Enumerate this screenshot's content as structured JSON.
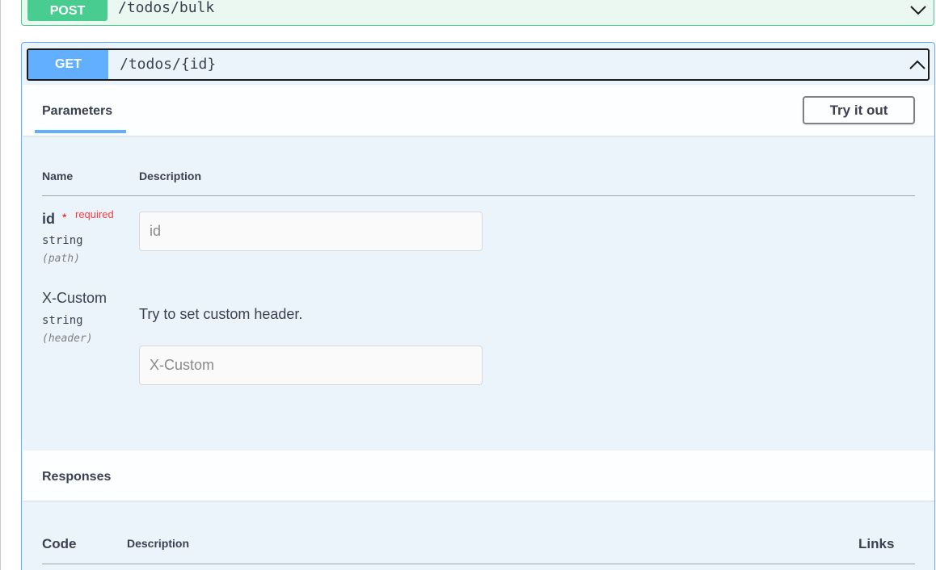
{
  "post_op": {
    "method": "POST",
    "path": "/todos/bulk"
  },
  "get_op": {
    "method": "GET",
    "path": "/todos/{id}"
  },
  "parameters": {
    "tab_label": "Parameters",
    "try_button": "Try it out",
    "header_name": "Name",
    "header_description": "Description",
    "items": [
      {
        "name": "id",
        "required_star": "*",
        "required_label": "required",
        "type": "string",
        "in": "(path)",
        "description": "",
        "placeholder": "id"
      },
      {
        "name": "X-Custom",
        "type": "string",
        "in": "(header)",
        "description": "Try to set custom header.",
        "placeholder": "X-Custom"
      }
    ]
  },
  "responses": {
    "title": "Responses",
    "header_code": "Code",
    "header_description": "Description",
    "header_links": "Links"
  },
  "colors": {
    "post": "#49cc90",
    "get": "#61affe",
    "required": "#ff0000"
  }
}
